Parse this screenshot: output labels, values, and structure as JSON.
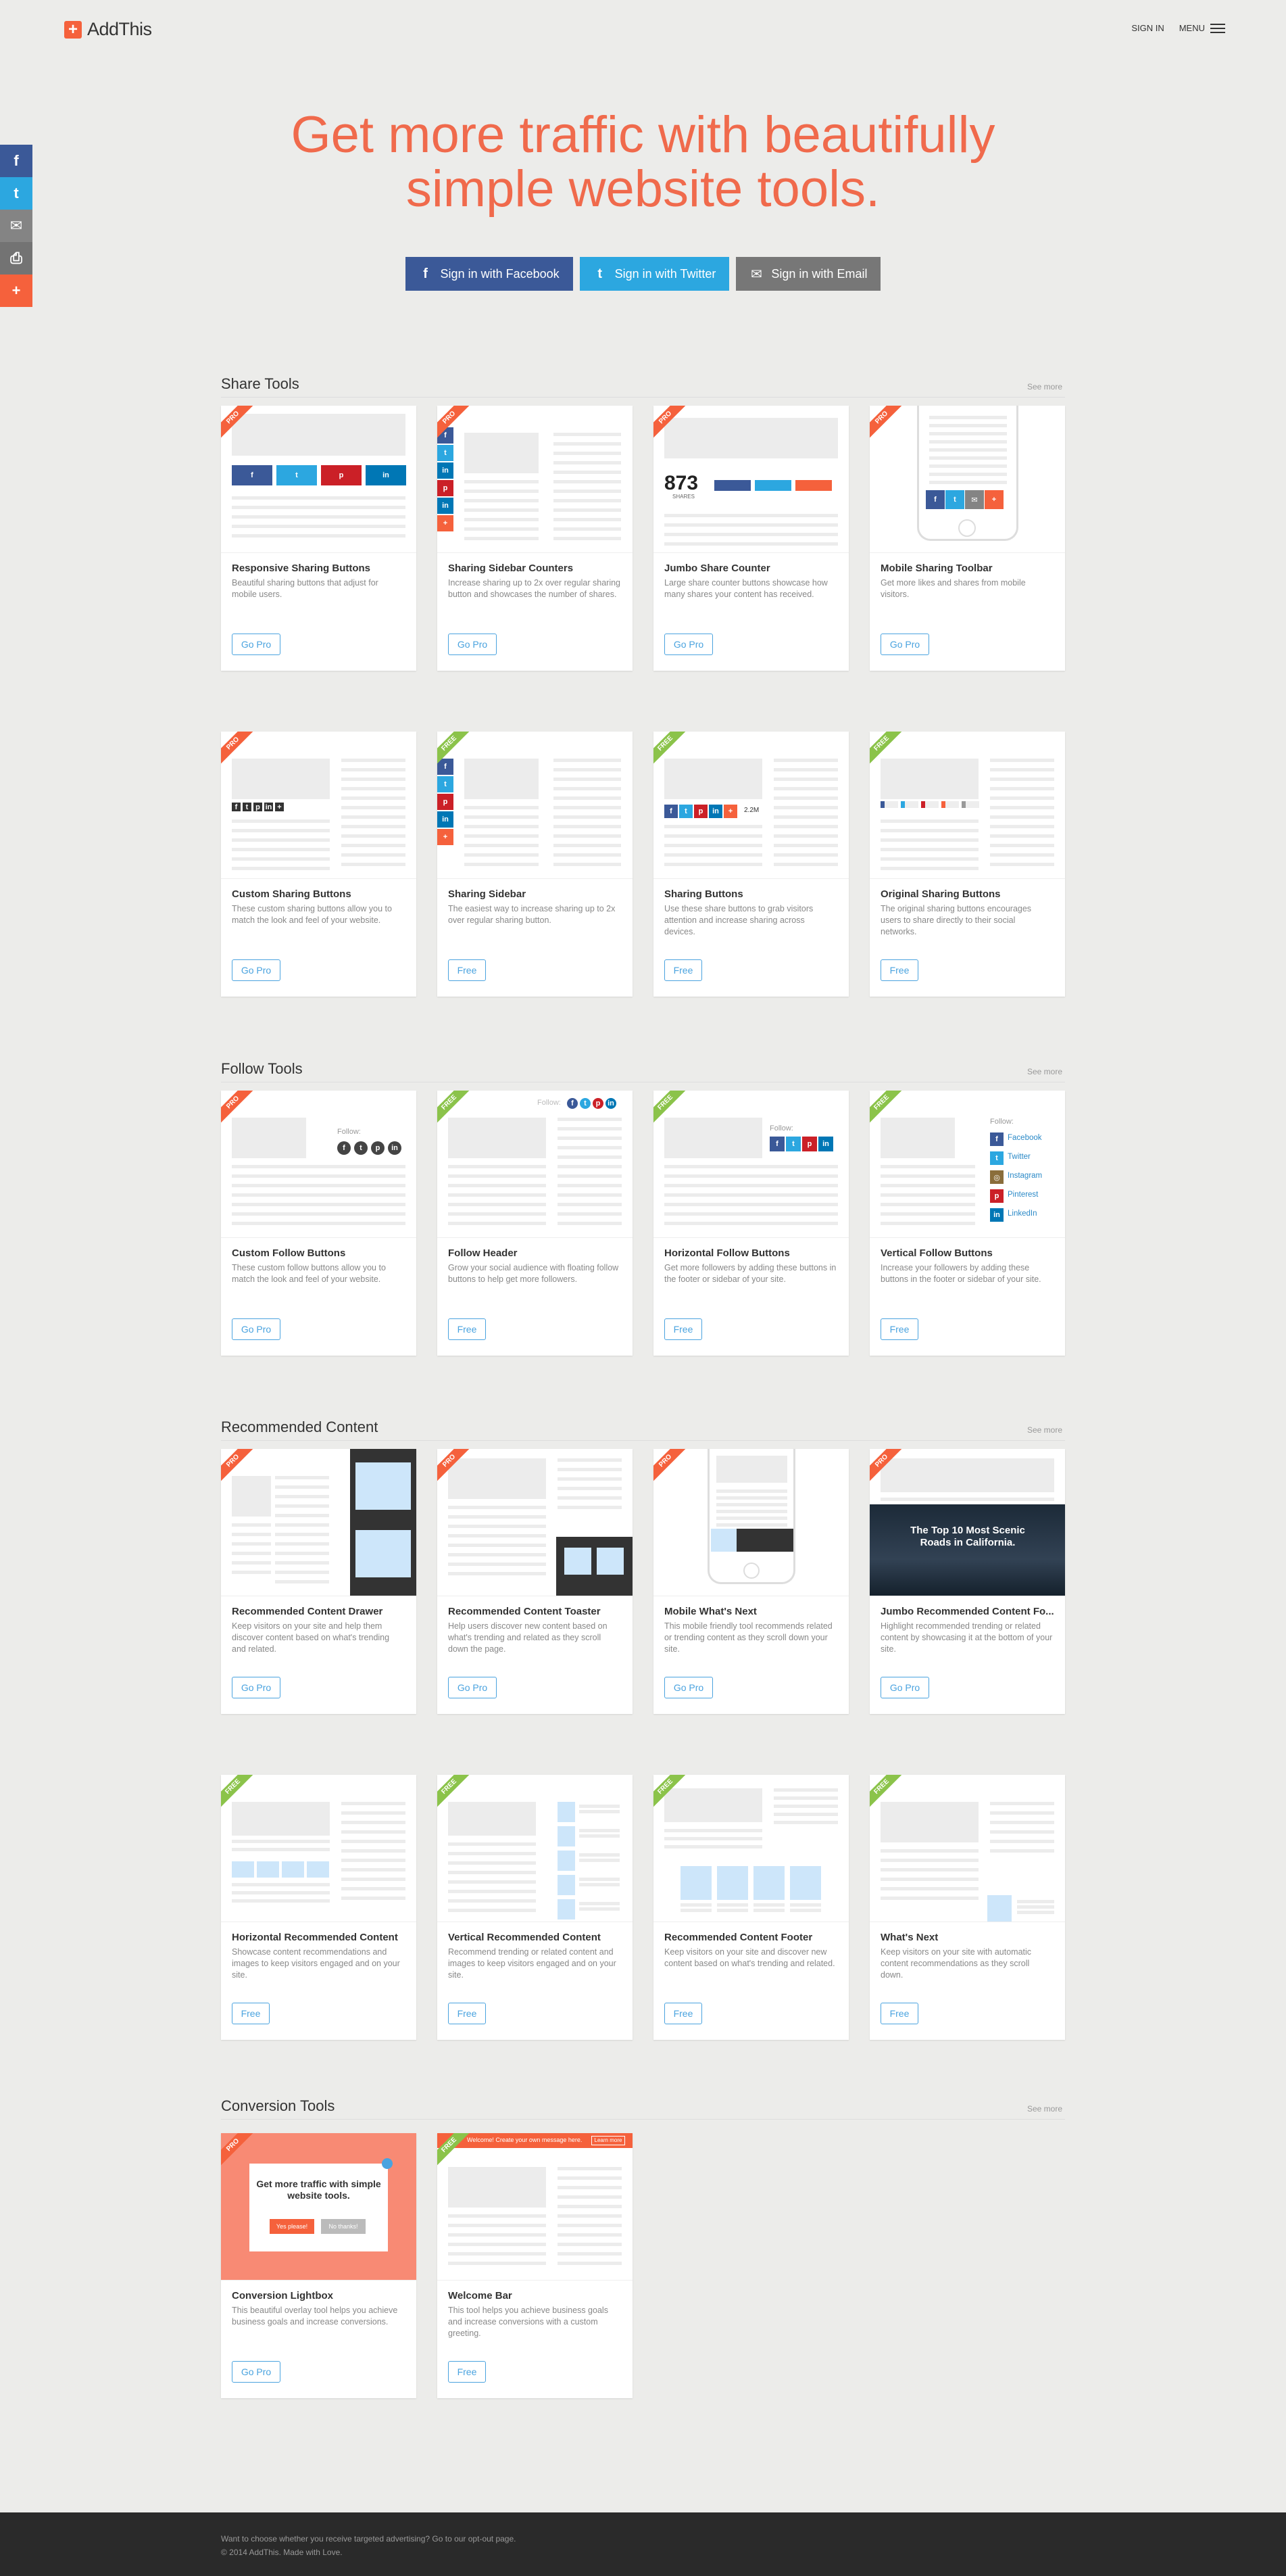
{
  "brand": {
    "name": "AddThis",
    "logo_glyph": "+"
  },
  "nav": {
    "sign_in": "SIGN IN",
    "menu": "MENU"
  },
  "side_share": [
    {
      "icon": "facebook-icon",
      "glyph": "f",
      "color": "#3b5998"
    },
    {
      "icon": "twitter-icon",
      "glyph": "t",
      "color": "#2ca7e0"
    },
    {
      "icon": "email-icon",
      "glyph": "✉",
      "color": "#848484"
    },
    {
      "icon": "print-icon",
      "glyph": "⎙",
      "color": "#737373"
    },
    {
      "icon": "more-icon",
      "glyph": "+",
      "color": "#f5613c"
    }
  ],
  "hero": {
    "line1": "Get more traffic with beautifully",
    "line2": "simple website tools."
  },
  "signin_buttons": [
    {
      "label": "Sign in with Facebook",
      "icon": "facebook-icon",
      "glyph": "f",
      "color": "#3b5998"
    },
    {
      "label": "Sign in with Twitter",
      "icon": "twitter-icon",
      "glyph": "t",
      "color": "#2ca7e0"
    },
    {
      "label": "Sign in with Email",
      "icon": "email-icon",
      "glyph": "✉",
      "color": "#777777"
    }
  ],
  "see_more": "See more",
  "sections": [
    {
      "title": "Share Tools"
    },
    {
      "title": "Follow Tools"
    },
    {
      "title": "Recommended Content"
    },
    {
      "title": "Conversion Tools"
    }
  ],
  "cards": [
    {
      "badge": "PRO",
      "title": "Responsive Sharing Buttons",
      "desc": "Beautiful sharing buttons that adjust for mobile users.",
      "button": "Go Pro"
    },
    {
      "badge": "PRO",
      "title": "Sharing Sidebar Counters",
      "desc": "Increase sharing up to 2x over regular sharing button and showcases the number of shares.",
      "button": "Go Pro"
    },
    {
      "badge": "PRO",
      "title": "Jumbo Share Counter",
      "desc": "Large share counter buttons showcase how many shares your content has received.",
      "button": "Go Pro"
    },
    {
      "badge": "PRO",
      "title": "Mobile Sharing Toolbar",
      "desc": "Get more likes and shares from mobile visitors.",
      "button": "Go Pro"
    },
    {
      "badge": "PRO",
      "title": "Custom Sharing Buttons",
      "desc": "These custom sharing buttons allow you to match the look and feel of your website.",
      "button": "Go Pro"
    },
    {
      "badge": "FREE",
      "title": "Sharing Sidebar",
      "desc": "The easiest way to increase sharing up to 2x over regular sharing button.",
      "button": "Free"
    },
    {
      "badge": "FREE",
      "title": "Sharing Buttons",
      "desc": "Use these share buttons to grab visitors attention and increase sharing across devices.",
      "button": "Free"
    },
    {
      "badge": "FREE",
      "title": "Original Sharing Buttons",
      "desc": "The original sharing buttons encourages users to share directly to their social networks.",
      "button": "Free"
    },
    {
      "badge": "PRO",
      "title": "Custom Follow Buttons",
      "desc": "These custom follow buttons allow you to match the look and feel of your website.",
      "button": "Go Pro"
    },
    {
      "badge": "FREE",
      "title": "Follow Header",
      "desc": "Grow your social audience with floating follow buttons to help get more followers.",
      "button": "Free"
    },
    {
      "badge": "FREE",
      "title": "Horizontal Follow Buttons",
      "desc": "Get more followers by adding these buttons in the footer or sidebar of your site.",
      "button": "Free"
    },
    {
      "badge": "FREE",
      "title": "Vertical Follow Buttons",
      "desc": "Increase your followers by adding these buttons in the footer or sidebar of your site.",
      "button": "Free"
    },
    {
      "badge": "PRO",
      "title": "Recommended Content Drawer",
      "desc": "Keep visitors on your site and help them discover content based on what's trending and related.",
      "button": "Go Pro"
    },
    {
      "badge": "PRO",
      "title": "Recommended Content Toaster",
      "desc": "Help users discover new content based on what's trending and related as they scroll down the page.",
      "button": "Go Pro"
    },
    {
      "badge": "PRO",
      "title": "Mobile What's Next",
      "desc": "This mobile friendly tool recommends related or trending content as they scroll down your site.",
      "button": "Go Pro"
    },
    {
      "badge": "PRO",
      "title": "Jumbo Recommended Content Fo...",
      "desc": "Highlight recommended trending or related content by showcasing it at the bottom of your site.",
      "button": "Go Pro"
    },
    {
      "badge": "FREE",
      "title": "Horizontal Recommended Content",
      "desc": "Showcase content recommendations and images to keep visitors engaged and on your site.",
      "button": "Free"
    },
    {
      "badge": "FREE",
      "title": "Vertical Recommended Content",
      "desc": "Recommend trending or related content and images to keep visitors engaged and on your site.",
      "button": "Free"
    },
    {
      "badge": "FREE",
      "title": "Recommended Content Footer",
      "desc": "Keep visitors on your site and discover new content based on what's trending and related.",
      "button": "Free"
    },
    {
      "badge": "FREE",
      "title": "What's Next",
      "desc": "Keep visitors on your site with automatic content recommendations as they scroll down.",
      "button": "Free"
    },
    {
      "badge": "PRO",
      "title": "Conversion Lightbox",
      "desc": "This beautiful overlay tool helps you achieve business goals and increase conversions.",
      "button": "Go Pro"
    },
    {
      "badge": "FREE",
      "title": "Welcome Bar",
      "desc": "This tool helps you achieve business goals and increase conversions with a custom greeting.",
      "button": "Free"
    }
  ],
  "previews": {
    "counter": {
      "number": "873",
      "label": "SHARES"
    },
    "share_count": "2.2M",
    "follow_label": "Follow:",
    "vertical_follow": [
      "Facebook",
      "Twitter",
      "Instagram",
      "Pinterest",
      "LinkedIn"
    ],
    "jumbo_heading": "The Top 10 Most Scenic Roads in California.",
    "lightbox": {
      "headline": "Get more traffic with simple website tools.",
      "btn1": "Yes please!",
      "btn2": "No thanks!"
    },
    "welcome_bar": {
      "text": "Welcome! Create your own message here.",
      "button": "Learn more"
    }
  },
  "footer": {
    "line1": "Want to choose whether you receive targeted advertising? Go to our opt-out page.",
    "line2": "© 2014 AddThis. Made with Love."
  }
}
